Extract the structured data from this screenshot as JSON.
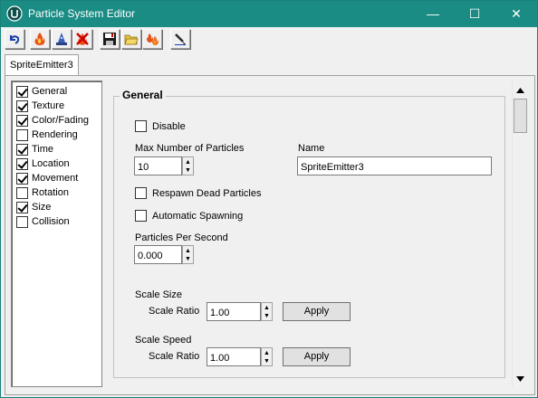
{
  "window": {
    "title": "Particle System Editor"
  },
  "titlebar": {
    "minimize": "—",
    "maximize": "☐",
    "close": "✕"
  },
  "toolbar": {
    "buttons": [
      {
        "name": "undo",
        "icon": "undo-arrow-icon"
      },
      {
        "name": "fire",
        "icon": "fire-icon"
      },
      {
        "name": "wizard",
        "icon": "wizard-icon"
      },
      {
        "name": "delete-fire",
        "icon": "delete-fire-icon"
      },
      {
        "name": "save",
        "icon": "floppy-disk-icon"
      },
      {
        "name": "open",
        "icon": "folder-icon"
      },
      {
        "name": "multi-fire",
        "icon": "multi-fire-icon"
      },
      {
        "name": "edit",
        "icon": "pen-icon"
      }
    ]
  },
  "tabs": [
    {
      "label": "SpriteEmitter3"
    }
  ],
  "sidebar": {
    "items": [
      {
        "label": "General",
        "checked": true
      },
      {
        "label": "Texture",
        "checked": true
      },
      {
        "label": "Color/Fading",
        "checked": true
      },
      {
        "label": "Rendering",
        "checked": false
      },
      {
        "label": "Time",
        "checked": true
      },
      {
        "label": "Location",
        "checked": true
      },
      {
        "label": "Movement",
        "checked": true
      },
      {
        "label": "Rotation",
        "checked": false
      },
      {
        "label": "Size",
        "checked": true
      },
      {
        "label": "Collision",
        "checked": false
      }
    ]
  },
  "general": {
    "group_title": "General",
    "disable_label": "Disable",
    "max_particles_label": "Max Number of Particles",
    "max_particles_value": "10",
    "name_label": "Name",
    "name_value": "SpriteEmitter3",
    "respawn_label": "Respawn Dead Particles",
    "auto_spawn_label": "Automatic Spawning",
    "pps_label": "Particles Per Second",
    "pps_value": "0.000",
    "scale_size_label": "Scale Size",
    "scale_size_ratio_label": "Scale Ratio",
    "scale_size_ratio_value": "1.00",
    "scale_size_apply": "Apply",
    "scale_speed_label": "Scale Speed",
    "scale_speed_ratio_label": "Scale Ratio",
    "scale_speed_ratio_value": "1.00",
    "scale_speed_apply": "Apply"
  },
  "colors": {
    "titlebar": "#1a8c84"
  }
}
